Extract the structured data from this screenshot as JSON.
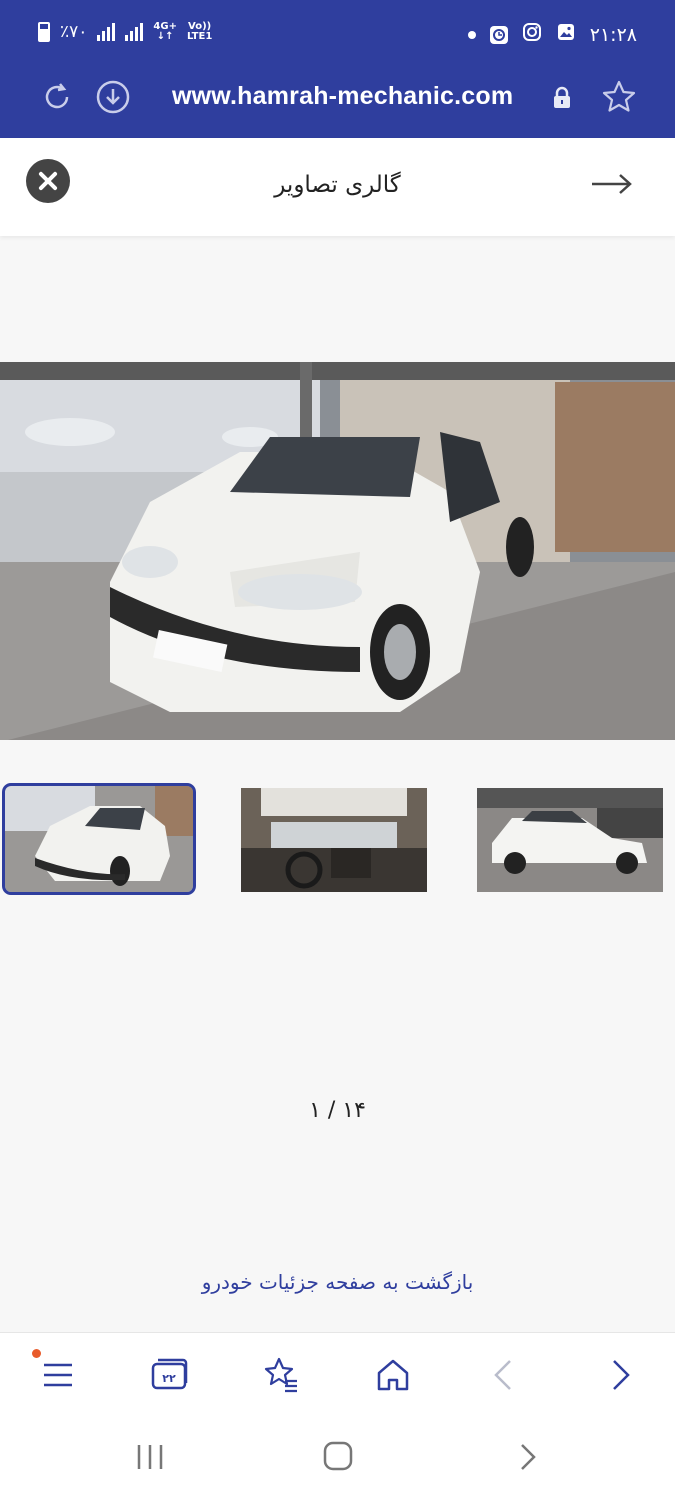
{
  "status_bar": {
    "battery": "٪۷۰",
    "network": [
      "4G+",
      "LTE1"
    ],
    "volte": "Vo))",
    "time": "۲۱:۲۸"
  },
  "browser": {
    "url": "www.hamrah-mechanic.com",
    "icons": [
      "refresh-icon",
      "download-icon",
      "lock-icon",
      "star-icon"
    ]
  },
  "gallery": {
    "title": "گالری تصاویر",
    "counter": "۱ / ۱۴",
    "back_link": "بازگشت به صفحه جزئیات خودرو"
  },
  "bottom_nav": {
    "tabs_count": "۲۲",
    "items": [
      "menu-icon",
      "tabs-icon",
      "bookmarks-icon",
      "home-icon",
      "back-icon",
      "forward-icon"
    ]
  },
  "colors": {
    "brand": "#2f3e9e",
    "accent_dot": "#e85b2b"
  }
}
